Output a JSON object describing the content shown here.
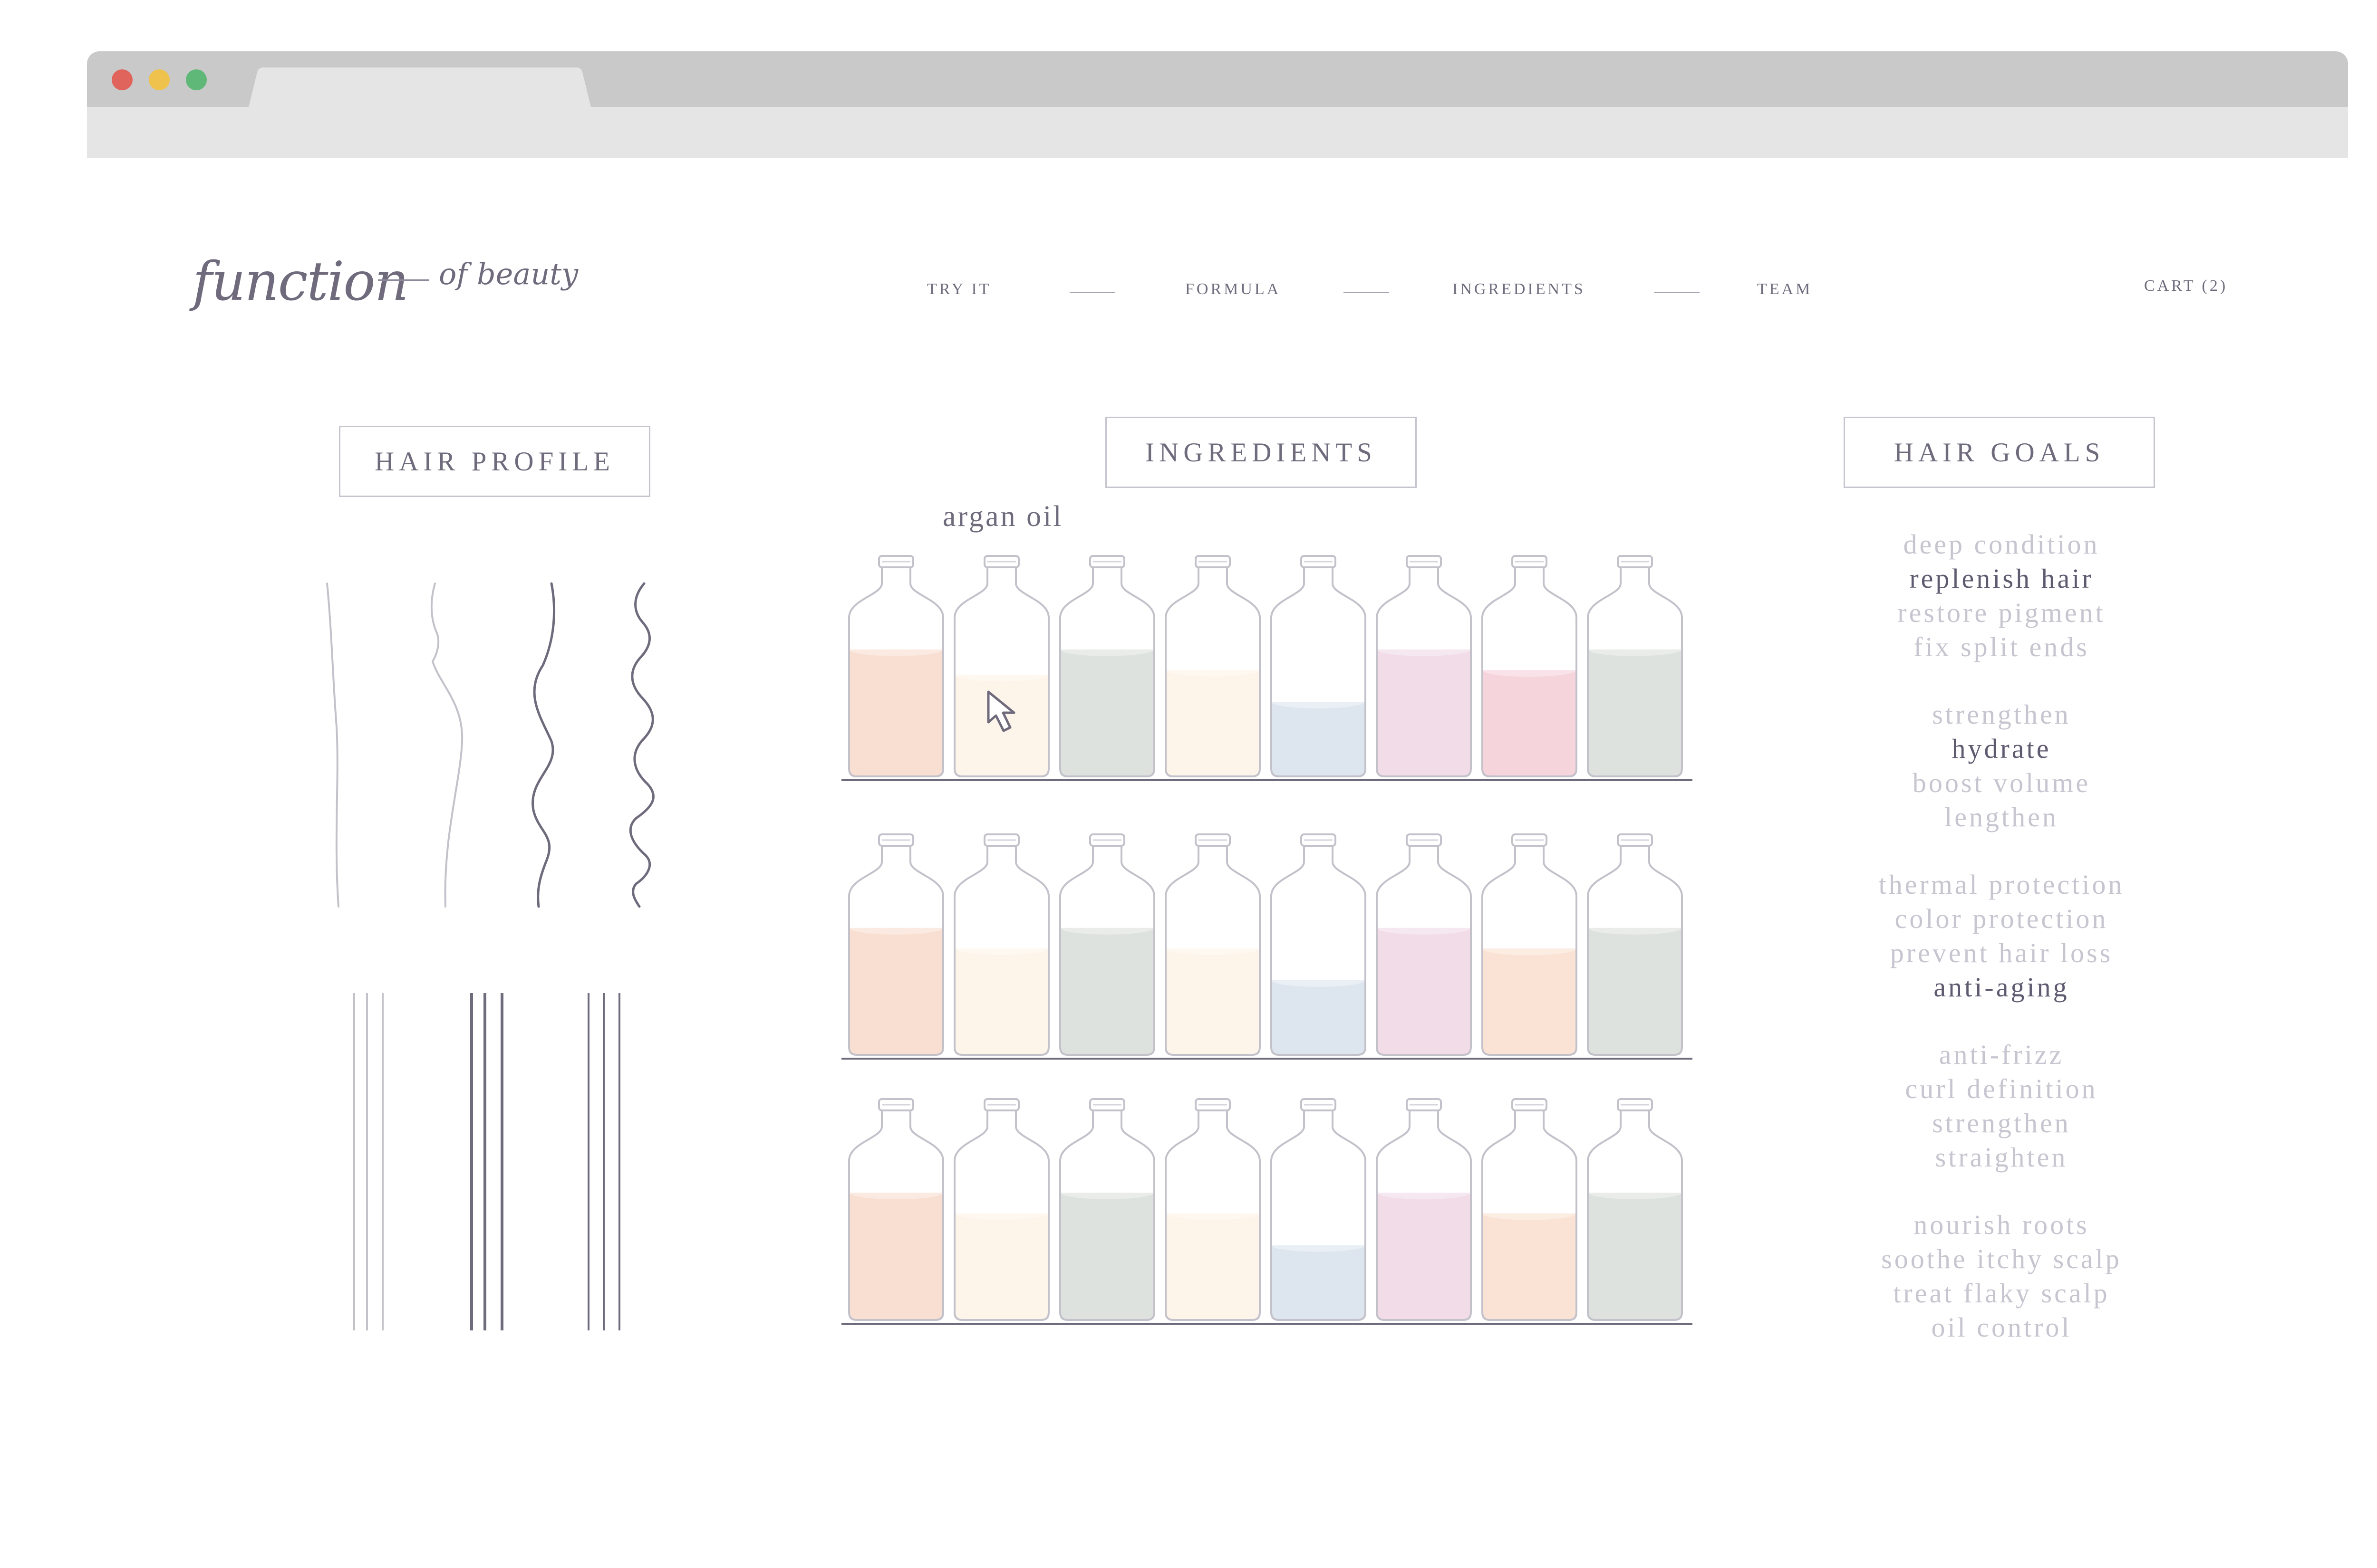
{
  "logo": {
    "main": "function",
    "sub": "of beauty"
  },
  "nav": {
    "items": [
      "TRY IT",
      "FORMULA",
      "INGREDIENTS",
      "TEAM"
    ],
    "cart": "CART (2)"
  },
  "sections": {
    "hair_profile": "HAIR PROFILE",
    "ingredients": "INGREDIENTS",
    "hair_goals": "HAIR GOALS"
  },
  "ingredient_hover_label": "argan oil",
  "colors": {
    "peach": "#f9dfd1",
    "cream": "#fdf4ea",
    "sage": "#dde2de",
    "blue": "#dde6ee",
    "lilac": "#f2dce8",
    "pink": "#f6d4dc",
    "apricot": "#fae3d5",
    "text": "#6f6a7c",
    "muted": "#c7c5cf"
  },
  "shelves": [
    [
      {
        "c": "peach",
        "l": 0.8
      },
      {
        "c": "cream",
        "l": 0.64
      },
      {
        "c": "sage",
        "l": 0.8
      },
      {
        "c": "cream",
        "l": 0.67
      },
      {
        "c": "blue",
        "l": 0.47
      },
      {
        "c": "lilac",
        "l": 0.8
      },
      {
        "c": "pink",
        "l": 0.67
      },
      {
        "c": "sage",
        "l": 0.8
      }
    ],
    [
      {
        "c": "peach",
        "l": 0.8
      },
      {
        "c": "cream",
        "l": 0.67
      },
      {
        "c": "sage",
        "l": 0.8
      },
      {
        "c": "cream",
        "l": 0.67
      },
      {
        "c": "blue",
        "l": 0.47
      },
      {
        "c": "lilac",
        "l": 0.8
      },
      {
        "c": "apricot",
        "l": 0.67
      },
      {
        "c": "sage",
        "l": 0.8
      }
    ],
    [
      {
        "c": "peach",
        "l": 0.8
      },
      {
        "c": "cream",
        "l": 0.67
      },
      {
        "c": "sage",
        "l": 0.8
      },
      {
        "c": "cream",
        "l": 0.67
      },
      {
        "c": "blue",
        "l": 0.47
      },
      {
        "c": "lilac",
        "l": 0.8
      },
      {
        "c": "apricot",
        "l": 0.67
      },
      {
        "c": "sage",
        "l": 0.8
      }
    ]
  ],
  "hair_goals": {
    "groups": [
      [
        {
          "t": "deep condition",
          "s": false
        },
        {
          "t": "replenish hair",
          "s": true
        },
        {
          "t": "restore pigment",
          "s": false
        },
        {
          "t": "fix split ends",
          "s": false
        }
      ],
      [
        {
          "t": "strengthen",
          "s": false
        },
        {
          "t": "hydrate",
          "s": true
        },
        {
          "t": "boost volume",
          "s": false
        },
        {
          "t": "lengthen",
          "s": false
        }
      ],
      [
        {
          "t": "thermal protection",
          "s": false
        },
        {
          "t": "color protection",
          "s": false
        },
        {
          "t": "prevent hair loss",
          "s": false
        },
        {
          "t": "anti-aging",
          "s": true
        }
      ],
      [
        {
          "t": "anti-frizz",
          "s": false
        },
        {
          "t": "curl definition",
          "s": false
        },
        {
          "t": "strengthen",
          "s": false
        },
        {
          "t": "straighten",
          "s": false
        }
      ],
      [
        {
          "t": "nourish roots",
          "s": false
        },
        {
          "t": "soothe itchy scalp",
          "s": false
        },
        {
          "t": "treat flaky scalp",
          "s": false
        },
        {
          "t": "oil control",
          "s": false
        }
      ]
    ]
  },
  "icons": {
    "cursor": "cursor-arrow-icon"
  }
}
